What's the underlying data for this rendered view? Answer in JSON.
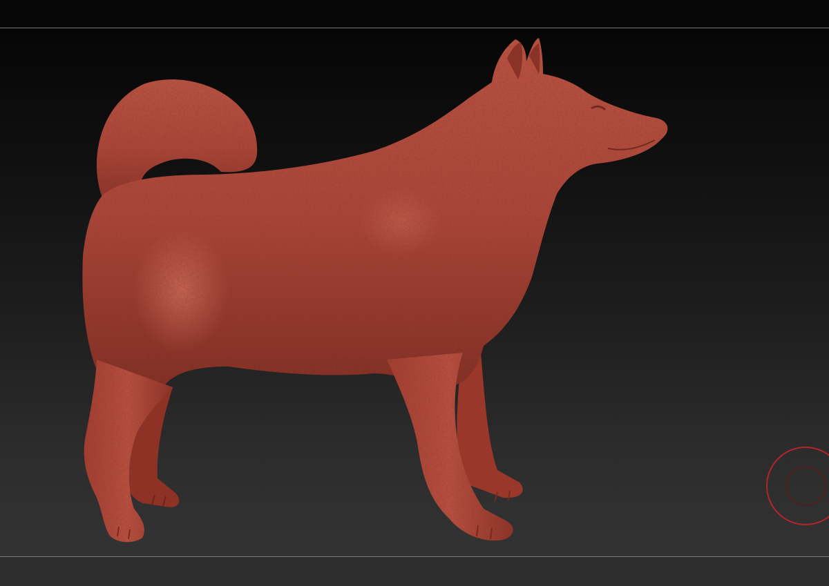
{
  "viewport": {
    "background_top": "#060606",
    "background_bottom": "#333333"
  },
  "model": {
    "subject": "dog",
    "material_color": "#b5483a",
    "shadow_color": "#7e2a20",
    "highlight_color": "#d9705f"
  },
  "gizmo": {
    "icon": "rotate-gizmo-icon",
    "color": "#b3262a"
  }
}
